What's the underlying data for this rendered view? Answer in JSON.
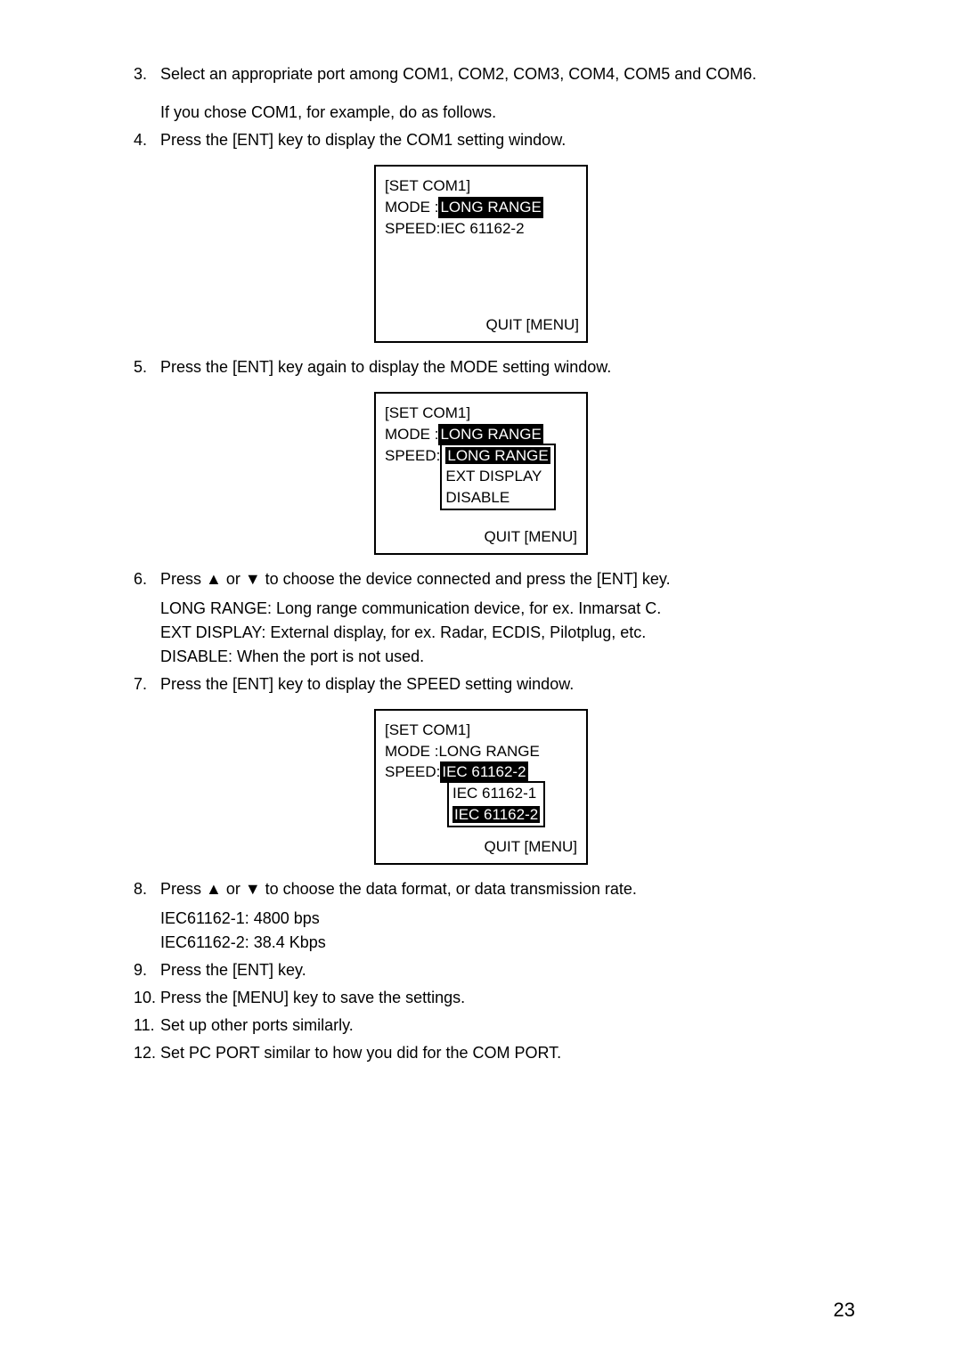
{
  "steps": {
    "s3": {
      "num": "3.",
      "text": "Select an appropriate port among COM1, COM2, COM3, COM4, COM5 and COM6.",
      "sub": "If you chose COM1, for example, do as follows."
    },
    "s4": {
      "num": "4.",
      "text": "Press the [ENT] key to display the COM1 setting window."
    },
    "s5": {
      "num": "5.",
      "text": "Press the [ENT] key again to display the MODE setting window."
    },
    "s6": {
      "num": "6.",
      "text": "Press ▲ or ▼ to choose the device connected and press the [ENT] key.",
      "lines": [
        "LONG RANGE: Long range communication device, for ex. Inmarsat C.",
        "EXT DISPLAY: External display, for ex. Radar, ECDIS, Pilotplug, etc.",
        "DISABLE: When the port is not used."
      ]
    },
    "s7": {
      "num": "7.",
      "text": "Press the [ENT] key to display the SPEED setting window."
    },
    "s8": {
      "num": "8.",
      "text": "Press ▲ or ▼ to choose the data format, or data transmission rate.",
      "lines": [
        "IEC61162-1: 4800 bps",
        "IEC61162-2: 38.4 Kbps"
      ]
    },
    "s9": {
      "num": "9.",
      "text": "Press the [ENT] key."
    },
    "s10": {
      "num": "10.",
      "text": "Press the [MENU] key to save the settings."
    },
    "s11": {
      "num": "11.",
      "text": "Set up other ports similarly."
    },
    "s12": {
      "num": "12.",
      "text": "Set PC PORT similar to how you did for the COM PORT."
    }
  },
  "screen1": {
    "title": "[SET COM1]",
    "mode_label": "MODE  : ",
    "mode_value": "LONG RANGE",
    "speed_label": "SPEED:  ",
    "speed_value": "IEC 61162-2",
    "quit": "QUIT [MENU]"
  },
  "screen2": {
    "title": "[SET COM1]",
    "mode_label": "MODE  : ",
    "mode_value": "LONG RANGE",
    "speed_label": "SPEED: ",
    "options": [
      "LONG RANGE",
      "EXT DISPLAY",
      "DISABLE"
    ],
    "quit": "QUIT [MENU]"
  },
  "screen3": {
    "title": "[SET COM1]",
    "mode_label": "MODE  :  ",
    "mode_value": "LONG RANGE",
    "speed_label": "SPEED: ",
    "speed_value": "IEC 61162-2",
    "options": [
      "IEC 61162-1",
      "IEC 61162-2"
    ],
    "quit": "QUIT [MENU]"
  },
  "page_number": "23"
}
